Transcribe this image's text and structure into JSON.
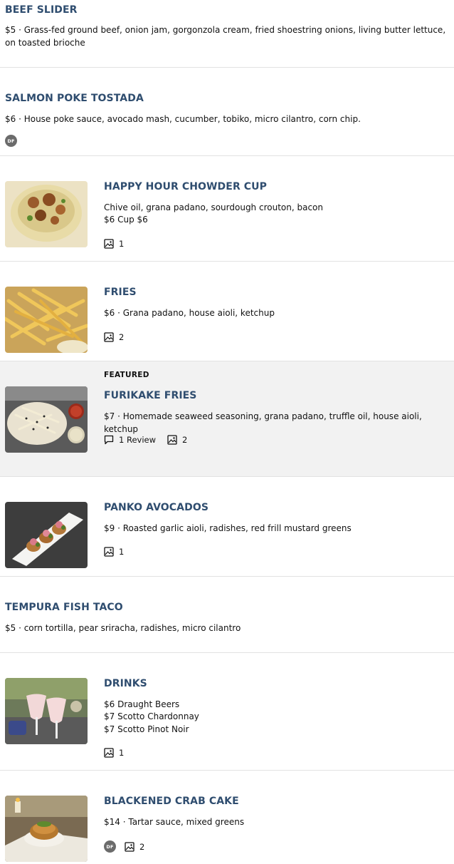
{
  "items": [
    {
      "title": "BEEF SLIDER",
      "desc": "$5 · Grass-fed ground beef, onion jam, gorgonzola cream, fried shoestring onions, living butter lettuce, on toasted brioche"
    },
    {
      "title": "SALMON POKE TOSTADA",
      "desc": "$6 · House poke sauce, avocado mash, cucumber, tobiko, micro cilantro, corn chip.",
      "badge": "DF"
    },
    {
      "title": "HAPPY HOUR CHOWDER CUP",
      "desc_lines": [
        "Chive oil, grana padano, sourdough crouton, bacon",
        "$6 Cup $6"
      ],
      "photos": "1"
    },
    {
      "title": "FRIES",
      "desc": "$6 · Grana padano, house aioli, ketchup",
      "photos": "2"
    },
    {
      "label": "FEATURED",
      "title": "FURIKAKE FRIES",
      "desc": "$7 · Homemade seaweed seasoning, grana padano, truffle oil, house aioli, ketchup",
      "reviews": "1 Review",
      "photos": "2"
    },
    {
      "title": "PANKO AVOCADOS",
      "desc": "$9 · Roasted garlic aioli, radishes, red frill mustard greens",
      "photos": "1"
    },
    {
      "title": "TEMPURA FISH TACO",
      "desc": "$5 · corn tortilla, pear sriracha, radishes, micro cilantro"
    },
    {
      "title": "DRINKS",
      "desc_lines": [
        "$6 Draught Beers",
        "$7 Scotto Chardonnay",
        "$7 Scotto Pinot Noir"
      ],
      "photos": "1"
    },
    {
      "title": "BLACKENED CRAB CAKE",
      "desc": "$14 · Tartar sauce, mixed greens",
      "badge": "DF",
      "photos": "2"
    }
  ],
  "icons": {
    "photo": "image-icon",
    "review": "comment-icon"
  },
  "colors": {
    "title": "#2f4d6f",
    "badge": "#6b6b6b",
    "featured_bg": "#f2f2f2"
  }
}
